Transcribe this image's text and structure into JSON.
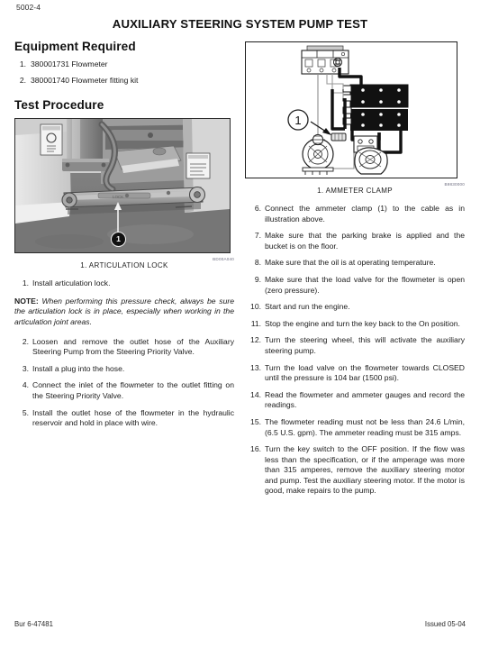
{
  "document": {
    "page_number": "5002-4",
    "title": "AUXILIARY STEERING SYSTEM PUMP TEST",
    "footer_left": "Bur 6-47481",
    "footer_right": "Issued 05-04"
  },
  "left_column": {
    "equipment_heading": "Equipment Required",
    "equipment_items": [
      {
        "num": "1.",
        "text": "380001731 Flowmeter"
      },
      {
        "num": "2.",
        "text": "380001740 Flowmeter fitting kit"
      }
    ],
    "procedure_heading": "Test Procedure",
    "figure": {
      "callout_label": "1",
      "caption": "1.  ARTICULATION LOCK",
      "code": "BD00A040"
    },
    "steps": [
      {
        "num": "1.",
        "text": "Install articulation lock."
      }
    ],
    "note": {
      "label": "NOTE:",
      "text": "When performing this pressure check, always be sure the articulation lock is in place, especially when working in the articulation joint areas."
    },
    "steps_cont": [
      {
        "num": "2.",
        "text": "Loosen and remove the outlet hose of the Auxiliary Steering Pump from the Steering Priority Valve."
      },
      {
        "num": "3.",
        "text": "Install a plug into the hose."
      },
      {
        "num": "4.",
        "text": "Connect the inlet of the flowmeter to the outlet fitting on the Steering Priority Valve."
      },
      {
        "num": "5.",
        "text": "Install the outlet hose of the flowmeter in the hydraulic reservoir and hold in place with wire."
      }
    ]
  },
  "right_column": {
    "figure": {
      "callout_label": "1",
      "caption": "1.  AMMETER CLAMP",
      "code": "B9830000"
    },
    "steps": [
      {
        "num": "6.",
        "text": "Connect the ammeter clamp (1) to the cable as in illustration above."
      },
      {
        "num": "7.",
        "text": "Make sure that the parking brake is applied and the bucket is on the floor."
      },
      {
        "num": "8.",
        "text": "Make sure that the oil is at operating temperature."
      },
      {
        "num": "9.",
        "text": "Make sure that the load valve for the flowmeter is open (zero pressure)."
      },
      {
        "num": "10.",
        "text": "Start and run the engine."
      },
      {
        "num": "11.",
        "text": "Stop the engine and turn the key back to the On position."
      },
      {
        "num": "12.",
        "text": "Turn the steering wheel, this will activate the auxiliary steering pump."
      },
      {
        "num": "13.",
        "text": "Turn the load valve on the flowmeter towards CLOSED until the pressure is 104 bar (1500 psi)."
      },
      {
        "num": "14.",
        "text": "Read the flowmeter and ammeter gauges and record the readings."
      },
      {
        "num": "15.",
        "text": "The flowmeter reading must not be less than 24.6 L/min, (6.5 U.S. gpm). The ammeter reading must be 315 amps."
      },
      {
        "num": "16.",
        "text": "Turn the key switch to the OFF position. If the flow was less than the specification, or if the amperage was more than 315 amperes, remove the auxiliary steering motor and pump. Test the auxiliary steering motor. If the motor is good, make repairs to the pump."
      }
    ]
  },
  "colors": {
    "text": "#1b1b1b",
    "rule": "#1d1d1d",
    "callout_fill": "#111111"
  }
}
